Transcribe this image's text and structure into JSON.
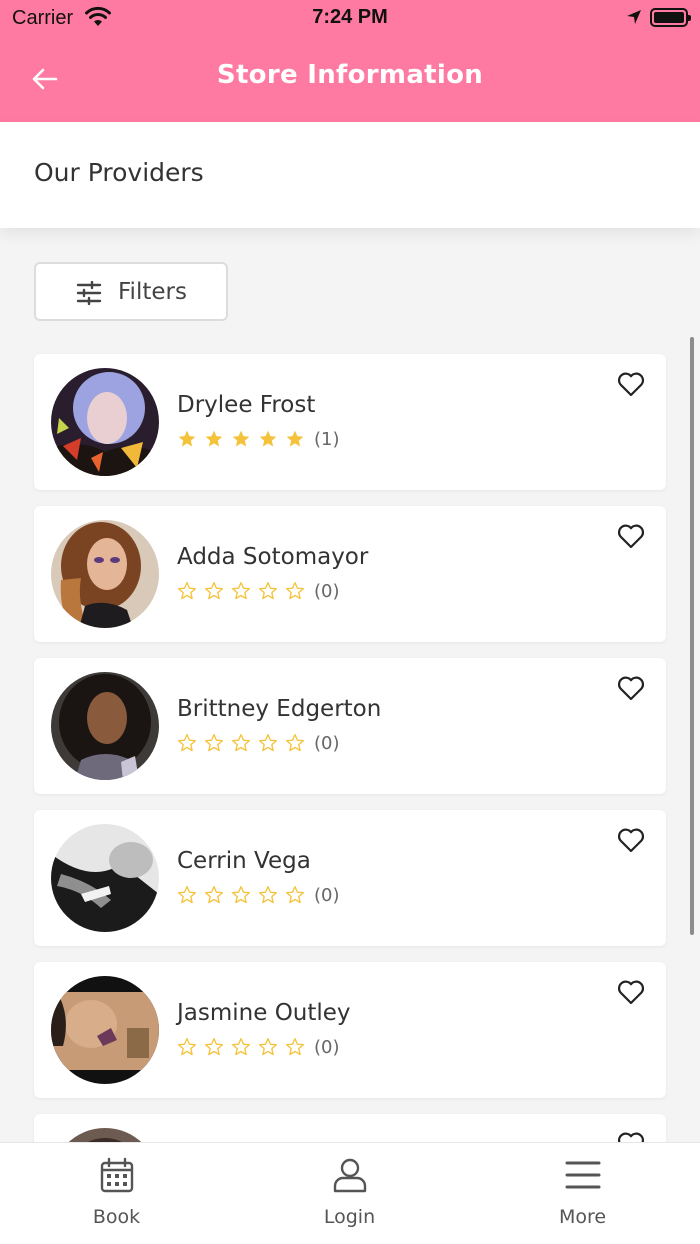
{
  "status_bar": {
    "carrier": "Carrier",
    "time": "7:24 PM"
  },
  "header": {
    "title": "Store Information"
  },
  "section": {
    "title": "Our Providers"
  },
  "filters": {
    "label": "Filters"
  },
  "colors": {
    "accent": "#ff7aa2",
    "star": "#f5c33b"
  },
  "providers": [
    {
      "name": "Drylee Frost",
      "rating": 5,
      "review_count": "(1)"
    },
    {
      "name": "Adda Sotomayor",
      "rating": 0,
      "review_count": "(0)"
    },
    {
      "name": "Brittney Edgerton",
      "rating": 0,
      "review_count": "(0)"
    },
    {
      "name": "Cerrin Vega",
      "rating": 0,
      "review_count": "(0)"
    },
    {
      "name": "Jasmine Outley",
      "rating": 0,
      "review_count": "(0)"
    }
  ],
  "tabs": [
    {
      "label": "Book",
      "icon": "calendar-icon"
    },
    {
      "label": "Login",
      "icon": "user-icon"
    },
    {
      "label": "More",
      "icon": "menu-icon"
    }
  ]
}
